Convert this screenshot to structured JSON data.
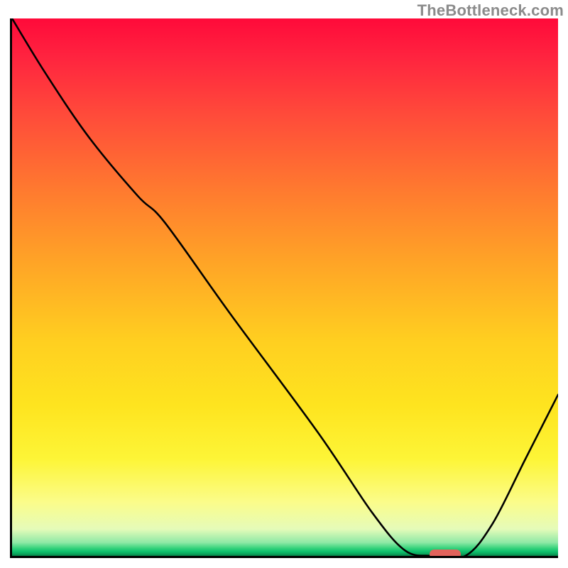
{
  "watermark": "TheBottleneck.com",
  "chart_data": {
    "type": "line",
    "title": "",
    "xlabel": "",
    "ylabel": "",
    "x_range": [
      0,
      100
    ],
    "y_range": [
      0,
      100
    ],
    "grid": false,
    "legend": false,
    "background_gradient": {
      "stops": [
        {
          "pos": 0,
          "color": "#ff0a3a"
        },
        {
          "pos": 0.32,
          "color": "#ff7a2f"
        },
        {
          "pos": 0.6,
          "color": "#ffcf20"
        },
        {
          "pos": 0.82,
          "color": "#fdf537"
        },
        {
          "pos": 0.95,
          "color": "#e5fbb9"
        },
        {
          "pos": 0.986,
          "color": "#33d17a"
        },
        {
          "pos": 1.0,
          "color": "#087a45"
        }
      ]
    },
    "curve": {
      "x": [
        0,
        6,
        14,
        23,
        28,
        40,
        56,
        66,
        72,
        77,
        83,
        88,
        94,
        100
      ],
      "y": [
        100,
        90,
        78,
        67,
        62,
        45,
        23,
        8,
        1,
        0,
        0,
        6,
        18,
        30
      ]
    },
    "minimum_marker": {
      "x": 79,
      "y": 0.8,
      "color": "#e2635c"
    },
    "axes": {
      "left": true,
      "bottom": true,
      "ticks": false
    }
  }
}
